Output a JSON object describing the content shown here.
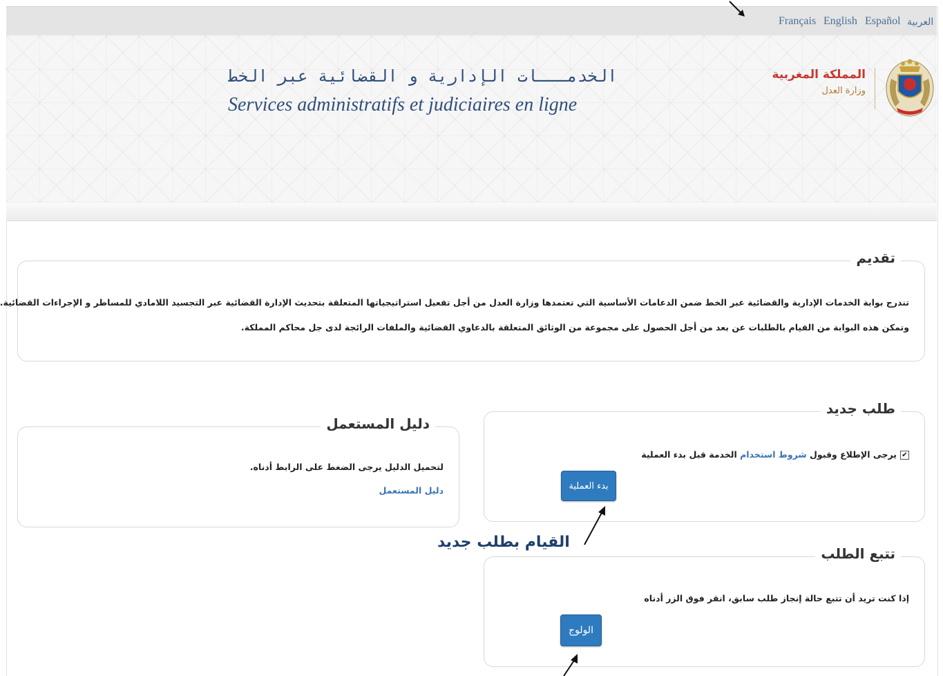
{
  "languages": [
    "Français",
    "English",
    "Español",
    "العربية"
  ],
  "header": {
    "title_ar": "الخدمـــات الإدارية و القضائية عبر الخط",
    "title_fr": "Services administratifs et judiciaires en ligne",
    "kingdom": "المملكة المغربية",
    "ministry": "وزارة العدل"
  },
  "intro": {
    "legend": "تقديم",
    "line1": "تندرج بوابة الخدمات الإدارية والقضائية عبر الخط ضمن الدعامات الأساسية التي تعتمدها وزارة العدل من أجل تفعيل استراتيجياتها المتعلقة بتحديث الإدارة القضائية عبر التجسيد اللامادي للمساطر و الإجراءات القضائية.",
    "line2": "وتمكن هذه البوابة من القيام بالطلبات عن بعد من أجل الحصول على مجموعة من الوثائق المتعلقة بالدعاوي القضائية والملفات الرائجة لدى جل محاكم المملكة."
  },
  "new_request": {
    "legend": "طلب جديد",
    "checkbox_checked": true,
    "terms_prefix": "يرجى الإطلاع وقبول",
    "terms_link": "شروط استخدام",
    "terms_suffix": "الخدمة قبل بدء العملية",
    "start_button": "بدء العملية"
  },
  "user_guide": {
    "legend": "دليل المستعمل",
    "text": "لتحميل الدليل يرجى الضغط على الرابط أدناه.",
    "link": "دليل المستعمل"
  },
  "track": {
    "legend": "تتبع الطلب",
    "text": "إذا كنت تريد أن تتبع حالة إنجاز طلب سابق، انقر فوق الزر أدناه",
    "login_button": "الولوج"
  },
  "annotation": {
    "new_request_label": "القيام بطلب جديد"
  }
}
